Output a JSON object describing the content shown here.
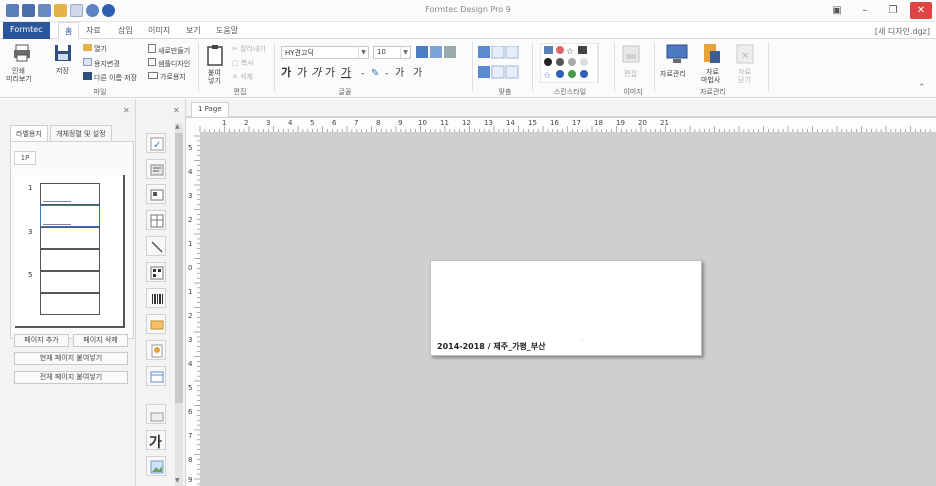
{
  "window": {
    "title": "Formtec Design Pro 9",
    "document_name": "[새 디자인.dgz]"
  },
  "menu": {
    "file": "Formtec",
    "tabs": [
      "홈",
      "자료",
      "삽입",
      "이미지",
      "보기",
      "도움말"
    ]
  },
  "ribbon": {
    "file_group": {
      "print_preview": "인쇄\n미리보기",
      "print_preview_l1": "인쇄",
      "print_preview_l2": "미리보기",
      "save": "저장",
      "open": "열기",
      "change_paper": "용지변경",
      "save_as": "다른 이름 저장",
      "new_open": "새로만들기",
      "sample_design": "샘플디자인",
      "landscape": "가로용지",
      "label": "파일"
    },
    "edit_group": {
      "paste_l1": "붙여",
      "paste_l2": "넣기",
      "cut": "잘라내기",
      "copy": "복사",
      "delete": "삭제",
      "label": "편집"
    },
    "font_group": {
      "font_name": "HY견고딕",
      "font_size": "10",
      "label": "글꼴"
    },
    "align_group": {
      "label": "맞춤"
    },
    "quick_style_group": {
      "label": "스킨스타일"
    },
    "image_group": {
      "edit": "편집",
      "label": "이미지"
    },
    "data_group": {
      "data_manage": "자료관리",
      "wizard_l1": "자료",
      "wizard_l2": "마법사",
      "close_l1": "자료",
      "close_l2": "닫기",
      "label": "자료관리"
    }
  },
  "left_panel": {
    "tabs": [
      "라벨용지",
      "개체정렬 및 설정"
    ],
    "sub_tab": "1P",
    "row_numbers": [
      "1",
      "3",
      "5"
    ],
    "buttons": {
      "add_page": "페이지 추가",
      "delete_page": "페이지 삭제",
      "paste_current": "현재 페이지 붙여넣기",
      "paste_all": "전체 페이지 붙여넣기"
    }
  },
  "document": {
    "tab": "1 Page",
    "label_text": "2014-2018 / 제주_가평_부산",
    "ruler_top": [
      "1",
      "2",
      "3",
      "4",
      "5",
      "6",
      "7",
      "8",
      "9",
      "10",
      "11",
      "12",
      "13",
      "14",
      "15",
      "16",
      "17",
      "18",
      "19",
      "20",
      "21"
    ],
    "ruler_left": [
      "5",
      "4",
      "3",
      "2",
      "1",
      "0",
      "1",
      "2",
      "3",
      "4",
      "5",
      "6",
      "7",
      "8",
      "9"
    ]
  },
  "colors": {
    "accent": "#2b579a",
    "canvas_bg": "#cfcfcf",
    "close_btn": "#e04343"
  }
}
